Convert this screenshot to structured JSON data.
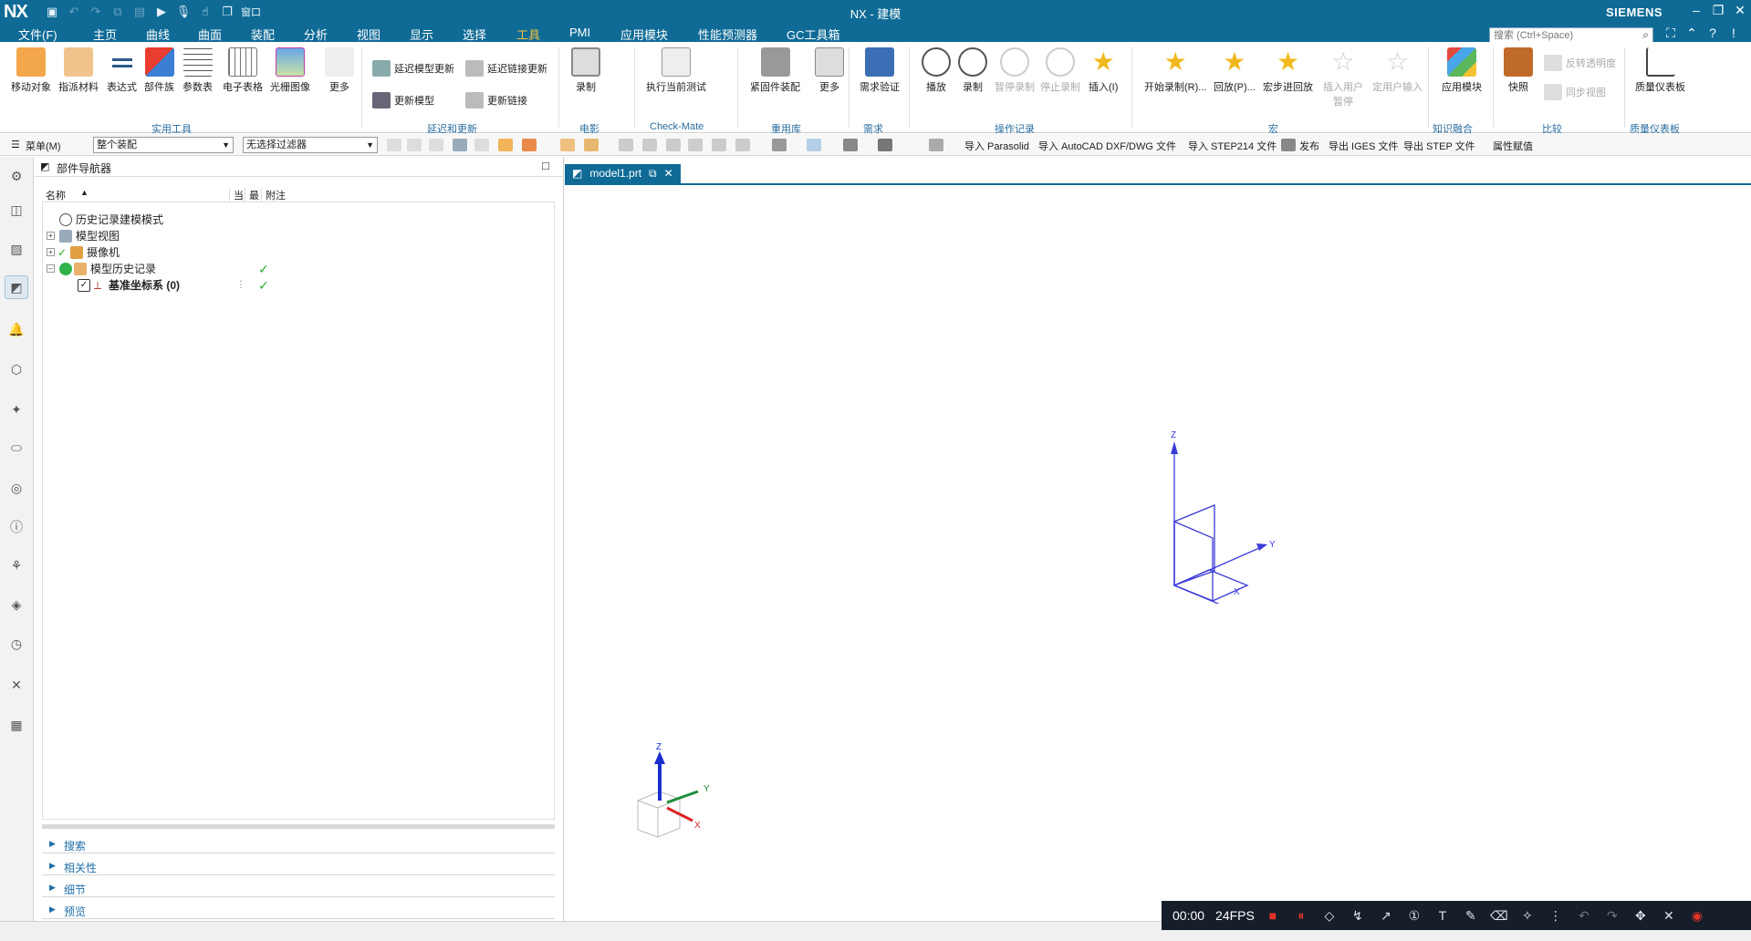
{
  "app": {
    "logo": "NX",
    "window_title": "NX - 建模",
    "brand": "SIEMENS"
  },
  "quick_access": {
    "window_menu": "窗口",
    "icons": [
      "save-icon",
      "undo-icon",
      "redo-icon",
      "copy-icon",
      "paste-icon",
      "play-icon",
      "microphone-icon",
      "hand-icon",
      "window-icon"
    ]
  },
  "menubar": {
    "tabs": [
      {
        "label": "文件(F)"
      },
      {
        "label": "主页"
      },
      {
        "label": "曲线"
      },
      {
        "label": "曲面"
      },
      {
        "label": "装配"
      },
      {
        "label": "分析"
      },
      {
        "label": "视图"
      },
      {
        "label": "显示"
      },
      {
        "label": "选择"
      },
      {
        "label": "工具"
      },
      {
        "label": "PMI"
      },
      {
        "label": "应用模块"
      },
      {
        "label": "性能预测器"
      },
      {
        "label": "GC工具箱"
      }
    ],
    "active": "工具"
  },
  "search": {
    "placeholder": "搜索 (Ctrl+Space)"
  },
  "ribbon": {
    "buttons": [
      {
        "label": "移动对象"
      },
      {
        "label": "指派材料"
      },
      {
        "label": "表达式"
      },
      {
        "label": "部件族"
      },
      {
        "label": "参数表"
      },
      {
        "label": "电子表格"
      },
      {
        "label": "光栅图像"
      },
      {
        "label": "更多"
      },
      {
        "label": "录制"
      },
      {
        "label": "执行当前测试"
      },
      {
        "label": "紧固件装配"
      },
      {
        "label": "更多"
      },
      {
        "label": "需求验证"
      },
      {
        "label": "播放"
      },
      {
        "label": "录制"
      },
      {
        "label": "暂停录制"
      },
      {
        "label": "停止录制"
      },
      {
        "label": "插入(I)"
      },
      {
        "label": "开始录制(R)..."
      },
      {
        "label": "回放(P)..."
      },
      {
        "label": "宏步进回放"
      },
      {
        "label": "插入用户暂停"
      },
      {
        "label": "定用户输入"
      },
      {
        "label": "应用模块"
      },
      {
        "label": "快照"
      },
      {
        "label": "质量仪表板"
      }
    ],
    "small_buttons": [
      {
        "label": "延迟模型更新"
      },
      {
        "label": "延迟链接更新"
      },
      {
        "label": "更新模型"
      },
      {
        "label": "更新链接"
      },
      {
        "label": "反转透明度"
      },
      {
        "label": "同步视图"
      }
    ],
    "groups": [
      {
        "label": "实用工具"
      },
      {
        "label": "延迟和更新"
      },
      {
        "label": "电影"
      },
      {
        "label": "Check-Mate"
      },
      {
        "label": "重用库"
      },
      {
        "label": "需求"
      },
      {
        "label": "操作记录"
      },
      {
        "label": "宏"
      },
      {
        "label": "知识融合"
      },
      {
        "label": "比较"
      },
      {
        "label": "质量仪表板"
      }
    ]
  },
  "toolbar2": {
    "menu": "菜单(M)",
    "assembly_select": "整个装配",
    "filter_select": "无选择过滤器",
    "commands": [
      {
        "label": "导入 Parasolid"
      },
      {
        "label": "导入 AutoCAD DXF/DWG 文件"
      },
      {
        "label": "导入 STEP214 文件"
      },
      {
        "label": "发布"
      },
      {
        "label": "导出 IGES 文件"
      },
      {
        "label": "导出 STEP 文件"
      },
      {
        "label": "属性赋值"
      }
    ]
  },
  "navigator": {
    "title": "部件导航器",
    "columns": [
      {
        "label": "名称"
      },
      {
        "label": "当"
      },
      {
        "label": "最"
      },
      {
        "label": "附注"
      }
    ],
    "rows": [
      {
        "label": "历史记录建模模式"
      },
      {
        "label": "模型视图"
      },
      {
        "label": "摄像机"
      },
      {
        "label": "模型历史记录"
      },
      {
        "label": "基准坐标系 (0)"
      }
    ],
    "panels": [
      {
        "label": "搜索"
      },
      {
        "label": "相关性"
      },
      {
        "label": "细节"
      },
      {
        "label": "预览"
      }
    ]
  },
  "viewport": {
    "tab_label": "model1.prt",
    "axes": {
      "x": "X",
      "y": "Y",
      "z": "Z"
    }
  },
  "recorder": {
    "time": "00:00",
    "fps": "24FPS"
  }
}
